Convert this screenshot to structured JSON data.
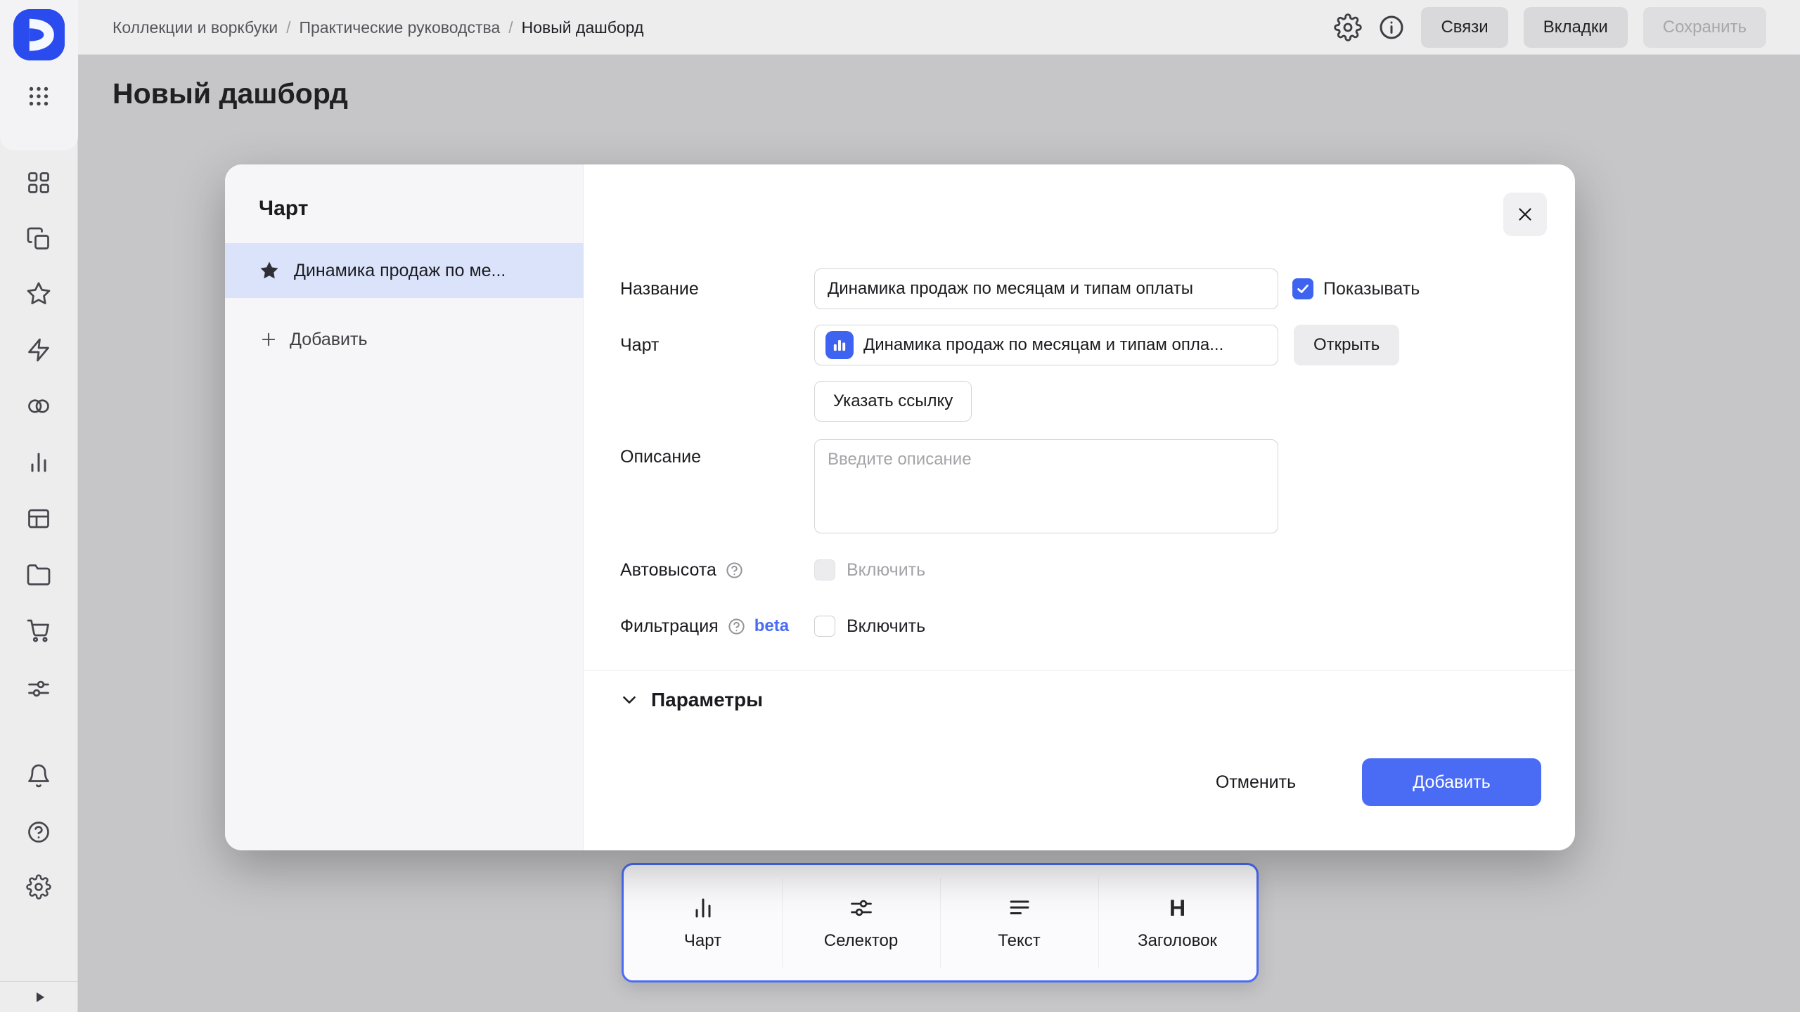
{
  "header": {
    "breadcrumbs": [
      "Коллекции и воркбуки",
      "Практические руководства",
      "Новый дашборд"
    ],
    "separator": "/",
    "links_button": "Связи",
    "tabs_button": "Вкладки",
    "save_button": "Сохранить"
  },
  "page": {
    "title": "Новый дашборд"
  },
  "sidebar": {
    "icons": [
      "datalens-logo",
      "apps-grid",
      "four-squares",
      "layers",
      "star",
      "lightning",
      "circles",
      "bar-chart",
      "table",
      "folder",
      "cart",
      "sliders",
      "bell",
      "help",
      "gear",
      "collapse-play"
    ]
  },
  "dialog": {
    "title": "Чарт",
    "items": [
      {
        "label": "Динамика продаж по ме...",
        "selected": true
      }
    ],
    "add_button": "Добавить",
    "fields": {
      "name": {
        "label": "Название",
        "value": "Динамика продаж по месяцам и типам оплаты"
      },
      "show_checkbox": "Показывать",
      "show_checked": true,
      "chart": {
        "label": "Чарт",
        "value": "Динамика продаж по месяцам и типам опла...",
        "open_button": "Открыть",
        "link_button": "Указать ссылку"
      },
      "description": {
        "label": "Описание",
        "placeholder": "Введите описание"
      },
      "autoheight": {
        "label": "Автовысота",
        "checkbox": "Включить",
        "checked": false,
        "disabled": true
      },
      "filtering": {
        "label": "Фильтрация",
        "badge": "beta",
        "checkbox": "Включить",
        "checked": false
      }
    },
    "params_section": "Параметры",
    "cancel_button": "Отменить",
    "submit_button": "Добавить"
  },
  "bottom_toolbar": {
    "items": [
      {
        "label": "Чарт",
        "icon": "bar-chart-icon"
      },
      {
        "label": "Селектор",
        "icon": "sliders-icon"
      },
      {
        "label": "Текст",
        "icon": "text-lines-icon"
      },
      {
        "label": "Заголовок",
        "icon": "heading-icon",
        "glyph": "H"
      }
    ]
  },
  "colors": {
    "accent_blue": "#4a6cf5",
    "checkbox_blue": "#3e63f0",
    "selected_item_bg": "#dbe3fb",
    "logo_blue": "#2a4bee",
    "dim_background": "#c6c6c8",
    "modal_bg": "#ffffff"
  }
}
